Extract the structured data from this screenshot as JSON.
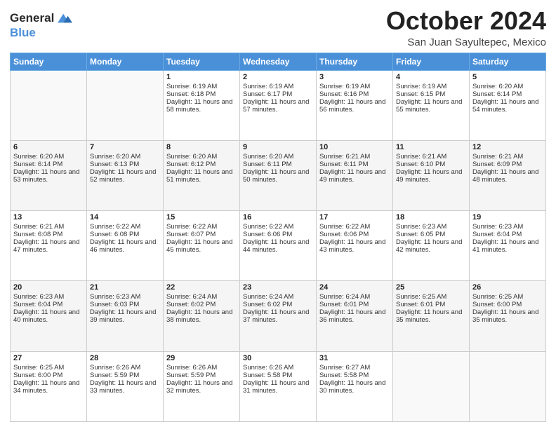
{
  "header": {
    "logo_line1": "General",
    "logo_line2": "Blue",
    "month": "October 2024",
    "location": "San Juan Sayultepec, Mexico"
  },
  "days_of_week": [
    "Sunday",
    "Monday",
    "Tuesday",
    "Wednesday",
    "Thursday",
    "Friday",
    "Saturday"
  ],
  "weeks": [
    [
      {
        "day": "",
        "sunrise": "",
        "sunset": "",
        "daylight": ""
      },
      {
        "day": "",
        "sunrise": "",
        "sunset": "",
        "daylight": ""
      },
      {
        "day": "1",
        "sunrise": "Sunrise: 6:19 AM",
        "sunset": "Sunset: 6:18 PM",
        "daylight": "Daylight: 11 hours and 58 minutes."
      },
      {
        "day": "2",
        "sunrise": "Sunrise: 6:19 AM",
        "sunset": "Sunset: 6:17 PM",
        "daylight": "Daylight: 11 hours and 57 minutes."
      },
      {
        "day": "3",
        "sunrise": "Sunrise: 6:19 AM",
        "sunset": "Sunset: 6:16 PM",
        "daylight": "Daylight: 11 hours and 56 minutes."
      },
      {
        "day": "4",
        "sunrise": "Sunrise: 6:19 AM",
        "sunset": "Sunset: 6:15 PM",
        "daylight": "Daylight: 11 hours and 55 minutes."
      },
      {
        "day": "5",
        "sunrise": "Sunrise: 6:20 AM",
        "sunset": "Sunset: 6:14 PM",
        "daylight": "Daylight: 11 hours and 54 minutes."
      }
    ],
    [
      {
        "day": "6",
        "sunrise": "Sunrise: 6:20 AM",
        "sunset": "Sunset: 6:14 PM",
        "daylight": "Daylight: 11 hours and 53 minutes."
      },
      {
        "day": "7",
        "sunrise": "Sunrise: 6:20 AM",
        "sunset": "Sunset: 6:13 PM",
        "daylight": "Daylight: 11 hours and 52 minutes."
      },
      {
        "day": "8",
        "sunrise": "Sunrise: 6:20 AM",
        "sunset": "Sunset: 6:12 PM",
        "daylight": "Daylight: 11 hours and 51 minutes."
      },
      {
        "day": "9",
        "sunrise": "Sunrise: 6:20 AM",
        "sunset": "Sunset: 6:11 PM",
        "daylight": "Daylight: 11 hours and 50 minutes."
      },
      {
        "day": "10",
        "sunrise": "Sunrise: 6:21 AM",
        "sunset": "Sunset: 6:11 PM",
        "daylight": "Daylight: 11 hours and 49 minutes."
      },
      {
        "day": "11",
        "sunrise": "Sunrise: 6:21 AM",
        "sunset": "Sunset: 6:10 PM",
        "daylight": "Daylight: 11 hours and 49 minutes."
      },
      {
        "day": "12",
        "sunrise": "Sunrise: 6:21 AM",
        "sunset": "Sunset: 6:09 PM",
        "daylight": "Daylight: 11 hours and 48 minutes."
      }
    ],
    [
      {
        "day": "13",
        "sunrise": "Sunrise: 6:21 AM",
        "sunset": "Sunset: 6:08 PM",
        "daylight": "Daylight: 11 hours and 47 minutes."
      },
      {
        "day": "14",
        "sunrise": "Sunrise: 6:22 AM",
        "sunset": "Sunset: 6:08 PM",
        "daylight": "Daylight: 11 hours and 46 minutes."
      },
      {
        "day": "15",
        "sunrise": "Sunrise: 6:22 AM",
        "sunset": "Sunset: 6:07 PM",
        "daylight": "Daylight: 11 hours and 45 minutes."
      },
      {
        "day": "16",
        "sunrise": "Sunrise: 6:22 AM",
        "sunset": "Sunset: 6:06 PM",
        "daylight": "Daylight: 11 hours and 44 minutes."
      },
      {
        "day": "17",
        "sunrise": "Sunrise: 6:22 AM",
        "sunset": "Sunset: 6:06 PM",
        "daylight": "Daylight: 11 hours and 43 minutes."
      },
      {
        "day": "18",
        "sunrise": "Sunrise: 6:23 AM",
        "sunset": "Sunset: 6:05 PM",
        "daylight": "Daylight: 11 hours and 42 minutes."
      },
      {
        "day": "19",
        "sunrise": "Sunrise: 6:23 AM",
        "sunset": "Sunset: 6:04 PM",
        "daylight": "Daylight: 11 hours and 41 minutes."
      }
    ],
    [
      {
        "day": "20",
        "sunrise": "Sunrise: 6:23 AM",
        "sunset": "Sunset: 6:04 PM",
        "daylight": "Daylight: 11 hours and 40 minutes."
      },
      {
        "day": "21",
        "sunrise": "Sunrise: 6:23 AM",
        "sunset": "Sunset: 6:03 PM",
        "daylight": "Daylight: 11 hours and 39 minutes."
      },
      {
        "day": "22",
        "sunrise": "Sunrise: 6:24 AM",
        "sunset": "Sunset: 6:02 PM",
        "daylight": "Daylight: 11 hours and 38 minutes."
      },
      {
        "day": "23",
        "sunrise": "Sunrise: 6:24 AM",
        "sunset": "Sunset: 6:02 PM",
        "daylight": "Daylight: 11 hours and 37 minutes."
      },
      {
        "day": "24",
        "sunrise": "Sunrise: 6:24 AM",
        "sunset": "Sunset: 6:01 PM",
        "daylight": "Daylight: 11 hours and 36 minutes."
      },
      {
        "day": "25",
        "sunrise": "Sunrise: 6:25 AM",
        "sunset": "Sunset: 6:01 PM",
        "daylight": "Daylight: 11 hours and 35 minutes."
      },
      {
        "day": "26",
        "sunrise": "Sunrise: 6:25 AM",
        "sunset": "Sunset: 6:00 PM",
        "daylight": "Daylight: 11 hours and 35 minutes."
      }
    ],
    [
      {
        "day": "27",
        "sunrise": "Sunrise: 6:25 AM",
        "sunset": "Sunset: 6:00 PM",
        "daylight": "Daylight: 11 hours and 34 minutes."
      },
      {
        "day": "28",
        "sunrise": "Sunrise: 6:26 AM",
        "sunset": "Sunset: 5:59 PM",
        "daylight": "Daylight: 11 hours and 33 minutes."
      },
      {
        "day": "29",
        "sunrise": "Sunrise: 6:26 AM",
        "sunset": "Sunset: 5:59 PM",
        "daylight": "Daylight: 11 hours and 32 minutes."
      },
      {
        "day": "30",
        "sunrise": "Sunrise: 6:26 AM",
        "sunset": "Sunset: 5:58 PM",
        "daylight": "Daylight: 11 hours and 31 minutes."
      },
      {
        "day": "31",
        "sunrise": "Sunrise: 6:27 AM",
        "sunset": "Sunset: 5:58 PM",
        "daylight": "Daylight: 11 hours and 30 minutes."
      },
      {
        "day": "",
        "sunrise": "",
        "sunset": "",
        "daylight": ""
      },
      {
        "day": "",
        "sunrise": "",
        "sunset": "",
        "daylight": ""
      }
    ]
  ]
}
